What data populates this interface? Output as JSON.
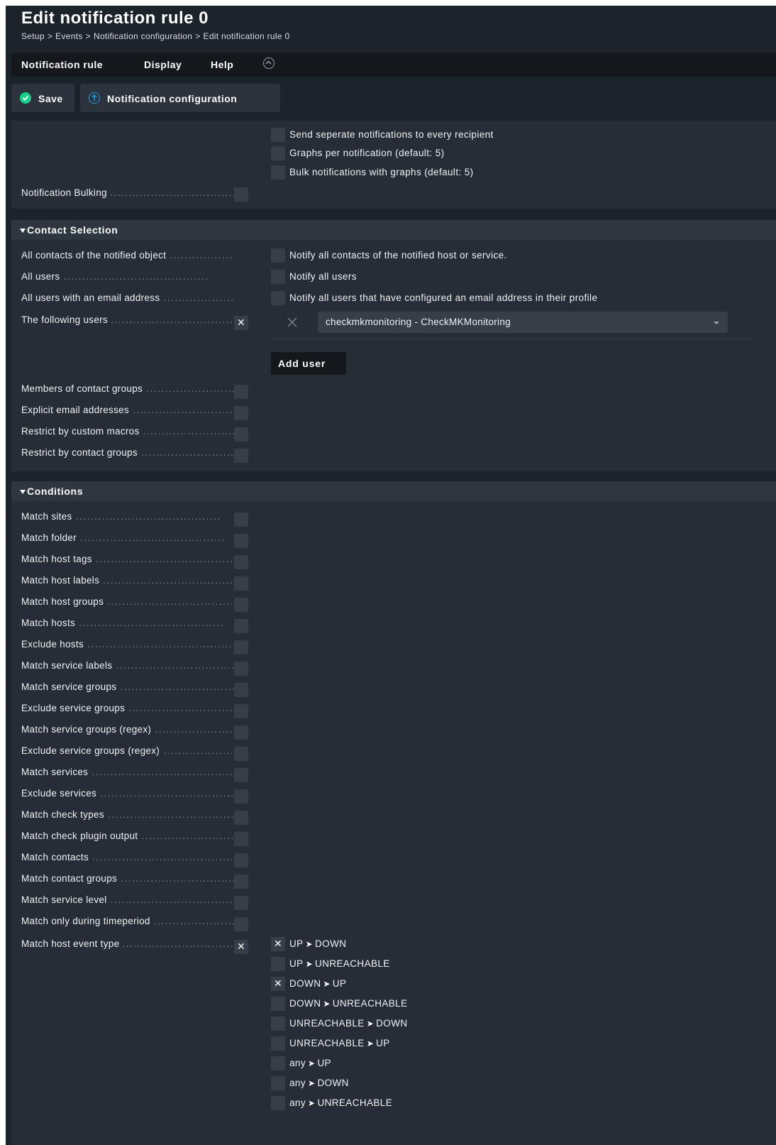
{
  "page": {
    "title": "Edit notification rule 0",
    "breadcrumb": [
      "Setup",
      "Events",
      "Notification configuration",
      "Edit notification rule 0"
    ],
    "breadcrumb_sep": ">"
  },
  "menubar": {
    "items": [
      "Notification rule",
      "Display",
      "Help"
    ]
  },
  "toolbar": {
    "save_label": "Save",
    "notification_config_label": "Notification configuration"
  },
  "bulk_section": {
    "options": [
      {
        "label": "Send seperate notifications to every recipient",
        "checked": false
      },
      {
        "label": "Graphs per notification (default: 5)",
        "checked": false
      },
      {
        "label": "Bulk notifications with graphs (default: 5)",
        "checked": false
      }
    ],
    "bulking_label": "Notification Bulking"
  },
  "contact_selection": {
    "header": "Contact Selection",
    "rows": [
      {
        "label": "All contacts of the notified object",
        "option": "Notify all contacts of the notified host or service."
      },
      {
        "label": "All users",
        "option": "Notify all users"
      },
      {
        "label": "All users with an email address",
        "option": "Notify all users that have configured an email address in their profile"
      }
    ],
    "following_users_label": "The following users",
    "selected_user": "checkmkmonitoring - CheckMKMonitoring",
    "add_user_label": "Add user",
    "more_rows": [
      "Members of contact groups",
      "Explicit email addresses",
      "Restrict by custom macros",
      "Restrict by contact groups"
    ]
  },
  "conditions": {
    "header": "Conditions",
    "rows": [
      "Match sites",
      "Match folder",
      "Match host tags",
      "Match host labels",
      "Match host groups",
      "Match hosts",
      "Exclude hosts",
      "Match service labels",
      "Match service groups",
      "Exclude service groups",
      "Match service groups (regex)",
      "Exclude service groups (regex)",
      "Match services",
      "Exclude services",
      "Match check types",
      "Match check plugin output",
      "Match contacts",
      "Match contact groups",
      "Match service level",
      "Match only during timeperiod"
    ],
    "host_event_label": "Match host event type",
    "host_events": [
      {
        "from": "UP",
        "to": "DOWN",
        "checked": true
      },
      {
        "from": "UP",
        "to": "UNREACHABLE",
        "checked": false
      },
      {
        "from": "DOWN",
        "to": "UP",
        "checked": true
      },
      {
        "from": "DOWN",
        "to": "UNREACHABLE",
        "checked": false
      },
      {
        "from": "UNREACHABLE",
        "to": "DOWN",
        "checked": false
      },
      {
        "from": "UNREACHABLE",
        "to": "UP",
        "checked": false
      },
      {
        "from": "any",
        "to": "UP",
        "checked": false
      },
      {
        "from": "any",
        "to": "DOWN",
        "checked": false
      },
      {
        "from": "any",
        "to": "UNREACHABLE",
        "checked": false
      }
    ]
  },
  "colors": {
    "background": "#1d232a",
    "panel": "#262d36",
    "checkbox": "#363e48",
    "save_icon": "#13d389",
    "info_icon": "#15a0e8"
  }
}
